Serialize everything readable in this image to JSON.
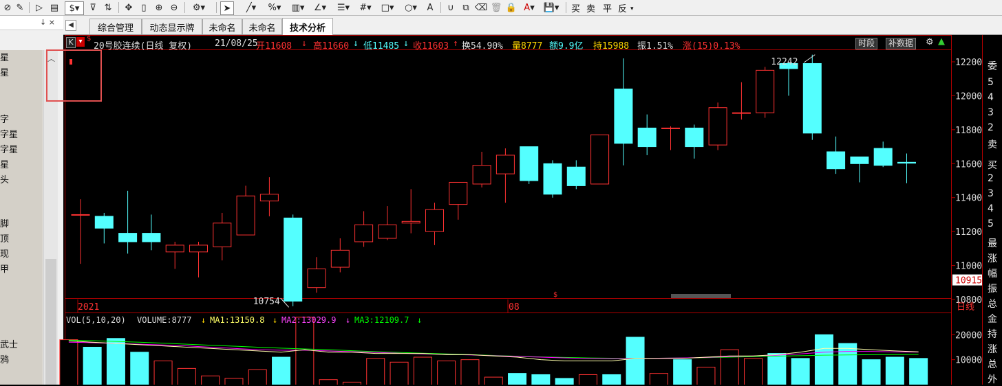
{
  "toolbar": {
    "icons": [
      "chart-icon",
      "edit-icon",
      "play-icon",
      "document-icon",
      "dollar-icon",
      "filter-icon",
      "list-icon",
      "move-icon",
      "bracket-icon",
      "zoom-in-icon",
      "zoom-out-icon",
      "settings-icon",
      "cursor-icon",
      "line-icon",
      "percent-icon",
      "ruler-icon",
      "angle-icon",
      "align-icon",
      "grid-icon",
      "rect-icon",
      "circle-icon",
      "text-icon",
      "magnet-icon",
      "copy-icon",
      "trash-icon",
      "lock-icon",
      "color-icon",
      "save-icon"
    ],
    "dollar": "$",
    "percent": "%",
    "text_a": "A",
    "color_a": "A",
    "trade_buy": "买",
    "trade_sell": "卖",
    "trade_flat": "平",
    "trade_reverse": "反"
  },
  "left_panel": {
    "pin": "↓ ×",
    "items": [
      "星",
      "星",
      "字",
      "字星",
      "字星",
      "星",
      "头",
      "脚",
      "顶",
      "现",
      "甲",
      "武士",
      "鸦"
    ]
  },
  "tabs": [
    "综合管理",
    "动态显示牌",
    "未命名",
    "未命名",
    "技术分析"
  ],
  "active_tab": 4,
  "header": {
    "k_label": "K",
    "dollar": "$",
    "title": "20号胶连续(日线 复权)",
    "date": "21/08/25",
    "open": "开11608",
    "high": "高11660",
    "low": "低11485",
    "close": "收11603",
    "turnover": "换54.90%",
    "volume": "量8777",
    "amount": "额9.9亿",
    "holding": "持15988",
    "amplitude": "振1.51%",
    "change": "涨(15)0.13%",
    "btn_period": "时段",
    "btn_supplement": "补数据"
  },
  "price_axis": [
    "12200",
    "12000",
    "11800",
    "11600",
    "11400",
    "11200",
    "11000",
    "10800"
  ],
  "current_price": "10915",
  "annotations": {
    "high": "12242",
    "low": "10754"
  },
  "time_axis": {
    "left": "2021",
    "mid": "08",
    "right": "日线"
  },
  "marker_dollar": "$",
  "volume_header": {
    "label": "VOL(5,10,20)",
    "volume": "VOLUME:8777",
    "ma1": "MA1:13150.8",
    "ma2": "MA2:13029.9",
    "ma3": "MA3:12109.7"
  },
  "volume_axis": [
    "20000",
    "10000"
  ],
  "right_panel": [
    "委",
    "5",
    "4",
    "3",
    "2",
    "卖",
    "买",
    "2",
    "3",
    "4",
    "5",
    "最",
    "涨",
    "幅",
    "振",
    "总",
    "金",
    "持",
    "涨",
    "总",
    "外"
  ],
  "colors": {
    "up": "#ff3232",
    "down": "#54ffff",
    "ma1": "#ffffff",
    "ma2": "#ff00ff",
    "ma3": "#00ff00",
    "frame": "#b00000",
    "annotation_box": "#e05050"
  },
  "chart_data": {
    "type": "candlestick",
    "title": "20号胶连续(日线 复权)",
    "ylim": [
      10700,
      12300
    ],
    "x_labels": [
      "2021",
      "08"
    ],
    "candles": [
      {
        "o": 11300,
        "h": 11390,
        "l": 11010,
        "c": 11300
      },
      {
        "o": 11290,
        "h": 11310,
        "l": 11130,
        "c": 11220
      },
      {
        "o": 11190,
        "h": 11440,
        "l": 11070,
        "c": 11140
      },
      {
        "o": 11190,
        "h": 11300,
        "l": 11090,
        "c": 11140
      },
      {
        "o": 11080,
        "h": 11140,
        "l": 10980,
        "c": 11120
      },
      {
        "o": 11080,
        "h": 11140,
        "l": 10930,
        "c": 11120
      },
      {
        "o": 11110,
        "h": 11310,
        "l": 11030,
        "c": 11250
      },
      {
        "o": 11180,
        "h": 11470,
        "l": 11180,
        "c": 11410
      },
      {
        "o": 11380,
        "h": 11520,
        "l": 11290,
        "c": 11420
      },
      {
        "o": 11280,
        "h": 11300,
        "l": 10760,
        "c": 10790
      },
      {
        "o": 10870,
        "h": 11050,
        "l": 10840,
        "c": 10980
      },
      {
        "o": 10990,
        "h": 11160,
        "l": 10960,
        "c": 11090
      },
      {
        "o": 11140,
        "h": 11320,
        "l": 11110,
        "c": 11240
      },
      {
        "o": 11160,
        "h": 11350,
        "l": 11150,
        "c": 11240
      },
      {
        "o": 11250,
        "h": 11450,
        "l": 11190,
        "c": 11260
      },
      {
        "o": 11200,
        "h": 11370,
        "l": 11120,
        "c": 11330
      },
      {
        "o": 11360,
        "h": 11490,
        "l": 11270,
        "c": 11490
      },
      {
        "o": 11480,
        "h": 11670,
        "l": 11460,
        "c": 11590
      },
      {
        "o": 11540,
        "h": 11690,
        "l": 11370,
        "c": 11650
      },
      {
        "o": 11700,
        "h": 11700,
        "l": 11480,
        "c": 11500
      },
      {
        "o": 11600,
        "h": 11620,
        "l": 11400,
        "c": 11420
      },
      {
        "o": 11580,
        "h": 11620,
        "l": 11450,
        "c": 11470
      },
      {
        "o": 11480,
        "h": 11770,
        "l": 11480,
        "c": 11770
      },
      {
        "o": 12040,
        "h": 12220,
        "l": 11590,
        "c": 11720
      },
      {
        "o": 11810,
        "h": 11890,
        "l": 11650,
        "c": 11700
      },
      {
        "o": 11810,
        "h": 11820,
        "l": 11680,
        "c": 11810
      },
      {
        "o": 11810,
        "h": 11830,
        "l": 11630,
        "c": 11700
      },
      {
        "o": 11710,
        "h": 11960,
        "l": 11680,
        "c": 11930
      },
      {
        "o": 11900,
        "h": 12080,
        "l": 11860,
        "c": 11900
      },
      {
        "o": 11900,
        "h": 12170,
        "l": 11870,
        "c": 12150
      },
      {
        "o": 12190,
        "h": 12200,
        "l": 12000,
        "c": 12160
      },
      {
        "o": 12190,
        "h": 12242,
        "l": 11740,
        "c": 11780
      },
      {
        "o": 11670,
        "h": 11760,
        "l": 11540,
        "c": 11570
      },
      {
        "o": 11640,
        "h": 11640,
        "l": 11490,
        "c": 11600
      },
      {
        "o": 11690,
        "h": 11730,
        "l": 11580,
        "c": 11590
      },
      {
        "o": 11608,
        "h": 11660,
        "l": 11485,
        "c": 11603
      }
    ],
    "volume": {
      "ylim": [
        0,
        26000
      ],
      "values": [
        18000,
        15000,
        18500,
        13000,
        9500,
        6500,
        3500,
        2500,
        6000,
        11000,
        27000,
        2000,
        1000,
        10500,
        9000,
        11000,
        9500,
        10000,
        3000,
        4500,
        4000,
        2500,
        4000,
        4000,
        19000,
        4500,
        10000,
        7000,
        14000,
        10500,
        12500,
        10500,
        20000,
        16500,
        10000,
        11000,
        10500
      ],
      "ma1": [
        17500,
        17000,
        16500,
        16000,
        15500,
        15000,
        14500,
        14000,
        13500,
        13000,
        14000,
        13000,
        13000,
        12500,
        12500,
        12500,
        12000,
        12000,
        11500,
        11000,
        10000,
        9500,
        9500,
        9500,
        10500,
        10500,
        10500,
        11000,
        11500,
        11500,
        12000,
        13000,
        14500,
        14500,
        14000,
        13500,
        13150.8
      ],
      "ma2": [
        17000,
        16800,
        16500,
        16200,
        15900,
        15500,
        15000,
        14500,
        14000,
        13800,
        13800,
        13500,
        13200,
        12900,
        12600,
        12300,
        12100,
        11900,
        11600,
        11300,
        11000,
        10700,
        10500,
        10400,
        10500,
        10600,
        10700,
        10900,
        11200,
        11500,
        11800,
        12300,
        13000,
        13300,
        13300,
        13100,
        13029.9
      ],
      "ma3": [
        17800,
        17600,
        17300,
        17000,
        16600,
        16200,
        15800,
        15400,
        15000,
        14600,
        14300,
        14000,
        13600,
        13200,
        12900,
        12600,
        12300,
        12000,
        11700,
        11400,
        11100,
        10900,
        10700,
        10600,
        10600,
        10600,
        10700,
        10800,
        11000,
        11200,
        11400,
        11600,
        11800,
        11900,
        12000,
        12050,
        12109.7
      ]
    }
  }
}
